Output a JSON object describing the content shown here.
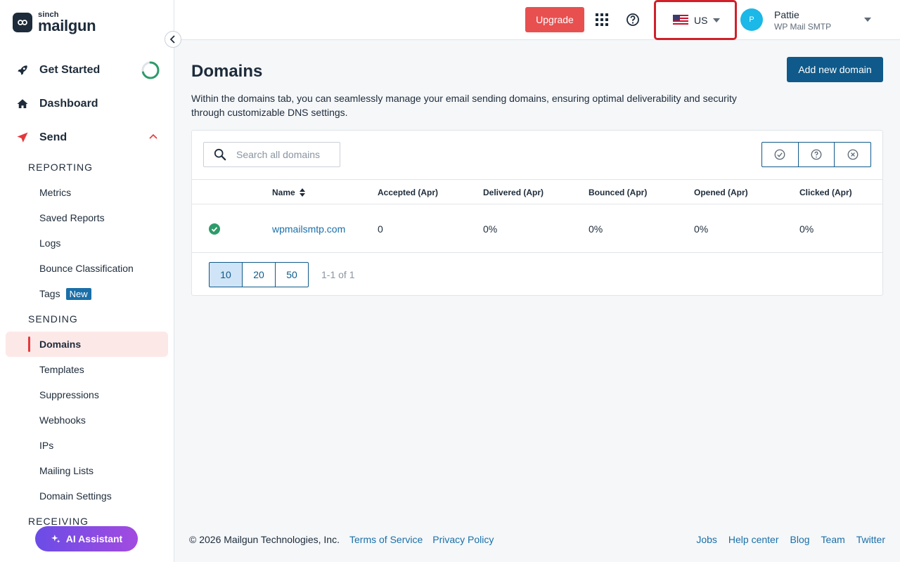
{
  "brand": {
    "sinch": "sinch",
    "name": "mailgun"
  },
  "sidebar": {
    "get_started": "Get Started",
    "get_started_progress": 0.7,
    "dashboard": "Dashboard",
    "send": "Send",
    "sections": [
      {
        "heading": "REPORTING",
        "items": [
          "Metrics",
          "Saved Reports",
          "Logs",
          "Bounce Classification",
          "Tags"
        ]
      },
      {
        "heading": "SENDING",
        "items": [
          "Domains",
          "Templates",
          "Suppressions",
          "Webhooks",
          "IPs",
          "Mailing Lists",
          "Domain Settings"
        ]
      },
      {
        "heading": "RECEIVING",
        "items": []
      }
    ],
    "tags_badge": "New",
    "active_item": "Domains",
    "ai_assistant": "AI Assistant"
  },
  "topbar": {
    "upgrade": "Upgrade",
    "region": "US",
    "user": {
      "initial": "P",
      "name": "Pattie",
      "org": "WP Mail SMTP"
    }
  },
  "main": {
    "title": "Domains",
    "add_button": "Add new domain",
    "description": "Within the domains tab, you can seamlessly manage your email sending domains, ensuring optimal deliverability and security through customizable DNS settings.",
    "search_placeholder": "Search all domains",
    "columns": [
      "Name",
      "Accepted (Apr)",
      "Delivered (Apr)",
      "Bounced (Apr)",
      "Opened (Apr)",
      "Clicked (Apr)"
    ],
    "rows": [
      {
        "name": "wpmailsmtp.com",
        "accepted": "0",
        "delivered": "0%",
        "bounced": "0%",
        "opened": "0%",
        "clicked": "0%"
      }
    ],
    "page_sizes": [
      "10",
      "20",
      "50"
    ],
    "active_page_size": "10",
    "pager_count": "1-1 of 1"
  },
  "footer": {
    "copyright": "© 2026 Mailgun Technologies, Inc.",
    "left_links": [
      "Terms of Service",
      "Privacy Policy"
    ],
    "right_links": [
      "Jobs",
      "Help center",
      "Blog",
      "Team",
      "Twitter"
    ]
  },
  "colors": {
    "accent_red": "#e5383b",
    "primary_blue": "#0f5a8a",
    "link_blue": "#1a6fa8",
    "success_green": "#2e9b6a"
  }
}
